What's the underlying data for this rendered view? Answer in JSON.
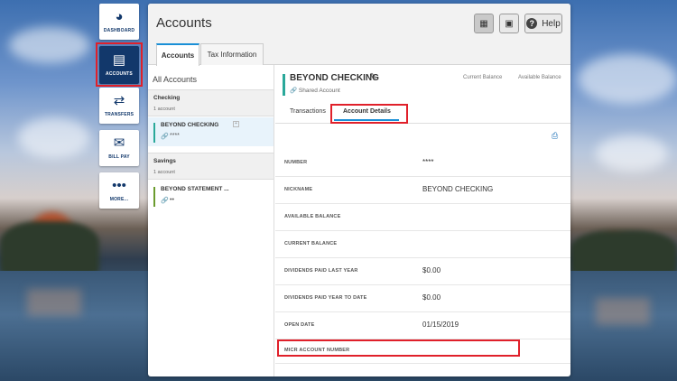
{
  "nav": {
    "items": [
      {
        "label": "DASHBOARD",
        "icon": "dashboard-gauge-icon"
      },
      {
        "label": "ACCOUNTS",
        "icon": "wallet-icon"
      },
      {
        "label": "TRANSFERS",
        "icon": "transfer-arrows-icon"
      },
      {
        "label": "BILL PAY",
        "icon": "bill-pay-icon"
      },
      {
        "label": "MORE...",
        "icon": "more-dots-icon"
      }
    ]
  },
  "header": {
    "title": "Accounts",
    "help_label": "Help",
    "tabs": [
      {
        "label": "Accounts"
      },
      {
        "label": "Tax Information"
      }
    ]
  },
  "list": {
    "title": "All Accounts",
    "groups": [
      {
        "name": "Checking",
        "count": "1 account",
        "accounts": [
          {
            "name": "BEYOND CHECKING",
            "number": "****",
            "color": "#2aa89a"
          }
        ]
      },
      {
        "name": "Savings",
        "count": "1 account",
        "accounts": [
          {
            "name": "BEYOND STATEMENT ...",
            "number": "••",
            "color": "#6b9b2e"
          }
        ]
      }
    ]
  },
  "detail": {
    "account_name": "BEYOND CHECKING",
    "shared": "Shared Account",
    "current_balance_label": "Current Balance",
    "available_balance_label": "Available Balance",
    "tabs": [
      {
        "label": "Transactions"
      },
      {
        "label": "Account Details"
      }
    ],
    "rows": [
      {
        "label": "NUMBER",
        "value": "****"
      },
      {
        "label": "NICKNAME",
        "value": "BEYOND CHECKING"
      },
      {
        "label": "AVAILABLE BALANCE",
        "value": ""
      },
      {
        "label": "CURRENT BALANCE",
        "value": ""
      },
      {
        "label": "DIVIDENDS PAID LAST YEAR",
        "value": "$0.00"
      },
      {
        "label": "DIVIDENDS PAID YEAR TO DATE",
        "value": "$0.00"
      },
      {
        "label": "OPEN DATE",
        "value": "01/15/2019"
      },
      {
        "label": "MICR ACCOUNT NUMBER",
        "value": ""
      }
    ]
  },
  "colors": {
    "brand": "#12386b",
    "accent": "#1a8fd6",
    "highlight": "#e0202a"
  }
}
